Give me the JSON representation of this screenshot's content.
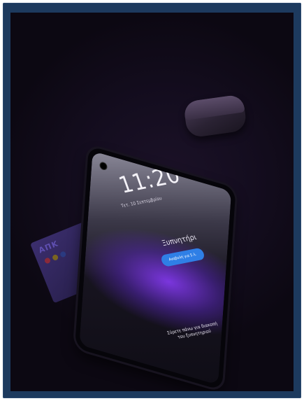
{
  "photo": {
    "subject": "smartphone-lock-screen-alarm",
    "card_text": "AΠK",
    "phone": {
      "time": "11:20",
      "date": "Τετ. 10 Σεπτεμβρίου",
      "alarm_title": "Ξυπνητήρι",
      "snooze_label": "Αναβολή για 5 λ.",
      "swipe_hint": "Σύρετε πάνω για διακοπή του ξυπνητηριού"
    },
    "colors": {
      "frame": "#1d3a5e",
      "accent": "#2f7fe6",
      "glow": "#8c3cff"
    }
  }
}
